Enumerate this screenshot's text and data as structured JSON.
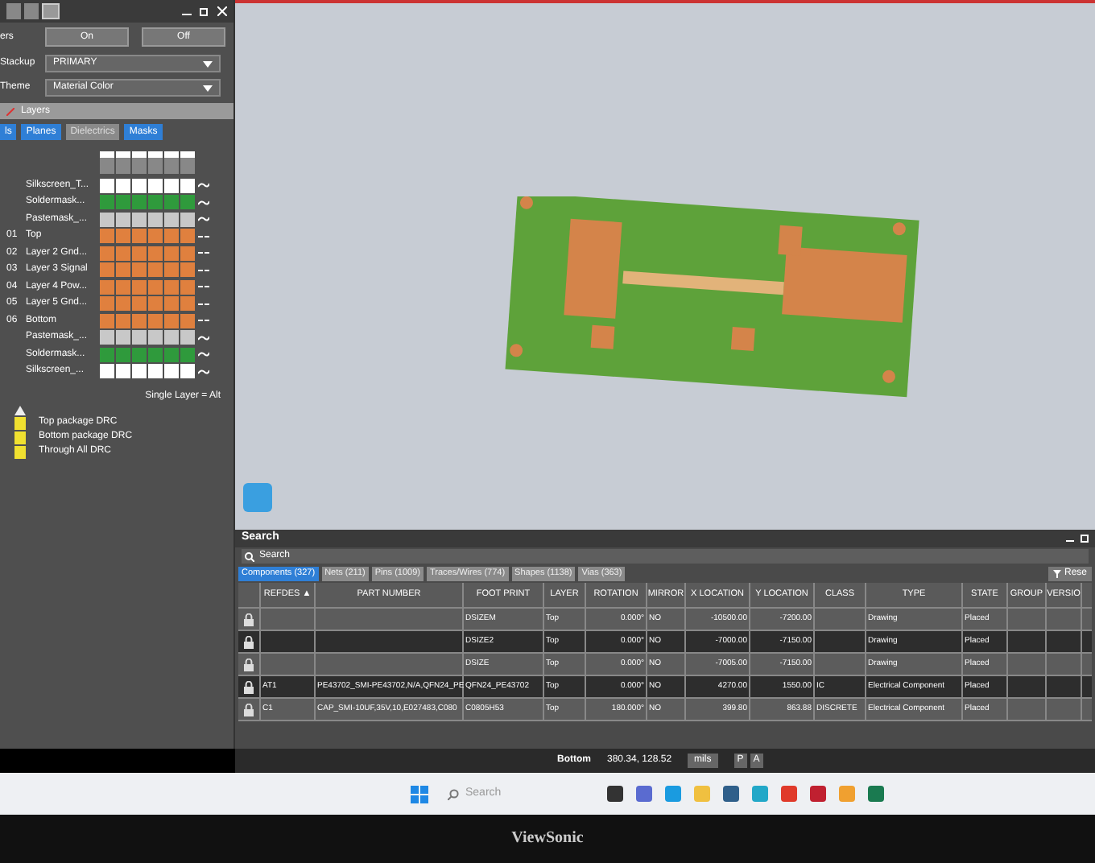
{
  "left_panel": {
    "section_label": "ers",
    "buttons": [
      "On",
      "Off"
    ],
    "stackup": {
      "label": "Stackup",
      "value": "PRIMARY"
    },
    "theme": {
      "label": "Theme",
      "value": "Material Color"
    },
    "layers_header": "Layers",
    "tabs": [
      {
        "label": "ls",
        "selected": true
      },
      {
        "label": "Planes",
        "selected": true
      },
      {
        "label": "Dielectrics",
        "selected": false
      },
      {
        "label": "Masks",
        "selected": true
      }
    ],
    "layers": [
      {
        "name": "Silkscreen_T...",
        "kind": "silk"
      },
      {
        "name": "Soldermask...",
        "kind": "solder"
      },
      {
        "name": "Pastemask_...",
        "kind": "paste"
      },
      {
        "number": "01",
        "name": "Top",
        "kind": "copper"
      },
      {
        "number": "02",
        "name": "Layer 2 Gnd...",
        "kind": "copper"
      },
      {
        "number": "03",
        "name": "Layer 3 Signal",
        "kind": "copper"
      },
      {
        "number": "04",
        "name": "Layer 4 Pow...",
        "kind": "copper"
      },
      {
        "number": "05",
        "name": "Layer 5 Gnd...",
        "kind": "copper"
      },
      {
        "number": "06",
        "name": "Bottom",
        "kind": "copper"
      },
      {
        "name": "Pastemask_...",
        "kind": "paste"
      },
      {
        "name": "Soldermask...",
        "kind": "solder"
      },
      {
        "name": "Silkscreen_...",
        "kind": "silk"
      }
    ],
    "single_layer_hint": "Single Layer = Alt",
    "drc_legend": [
      "Top package DRC",
      "Bottom package DRC",
      "Through All DRC"
    ]
  },
  "search_panel": {
    "title": "Search",
    "search_placeholder": "Search",
    "filter_button": "Rese",
    "tabs": [
      {
        "label": "Components (327)",
        "selected": true
      },
      {
        "label": "Nets (211)",
        "selected": false
      },
      {
        "label": "Pins (1009)",
        "selected": false
      },
      {
        "label": "Traces/Wires (774)",
        "selected": false
      },
      {
        "label": "Shapes (1138)",
        "selected": false
      },
      {
        "label": "Vias (363)",
        "selected": false
      }
    ],
    "columns": [
      "REFDES ▲",
      "PART NUMBER",
      "FOOT PRINT",
      "LAYER",
      "ROTATION",
      "MIRROR",
      "X LOCATION",
      "Y LOCATION",
      "CLASS",
      "TYPE",
      "STATE",
      "GROUP",
      "VERSIO"
    ],
    "rows": [
      {
        "cells": [
          null,
          null,
          "DSIZEM",
          "Top",
          "0.000°",
          "NO",
          "-10500.00",
          "-7200.00",
          null,
          "Drawing",
          "Placed",
          null,
          null
        ]
      },
      {
        "cells": [
          null,
          null,
          "DSIZE2",
          "Top",
          "0.000°",
          "NO",
          "-7000.00",
          "-7150.00",
          null,
          "Drawing",
          "Placed",
          null,
          null
        ]
      },
      {
        "cells": [
          null,
          null,
          "DSIZE",
          "Top",
          "0.000°",
          "NO",
          "-7005.00",
          "-7150.00",
          null,
          "Drawing",
          "Placed",
          null,
          null
        ]
      },
      {
        "cells": [
          "AT1",
          "PE43702_SMI-PE43702,N/A,QFN24_PE",
          "QFN24_PE43702",
          "Top",
          "0.000°",
          "NO",
          "4270.00",
          "1550.00",
          "IC",
          "Electrical Component",
          "Placed",
          null,
          null
        ]
      },
      {
        "cells": [
          "C1",
          "CAP_SMI-10UF,35V,10,E027483,C080",
          "C0805H53",
          "Top",
          "180.000°",
          "NO",
          "399.80",
          "863.88",
          "DISCRETE",
          "Electrical Component",
          "Placed",
          null,
          null
        ]
      }
    ]
  },
  "status_bar": {
    "layer": "Bottom",
    "coordinates": "380.34, 128.52",
    "units": "mils",
    "buttons": [
      "P",
      "A"
    ]
  },
  "taskbar": {
    "search_placeholder": "Search"
  },
  "monitor": {
    "brand": "ViewSonic"
  }
}
